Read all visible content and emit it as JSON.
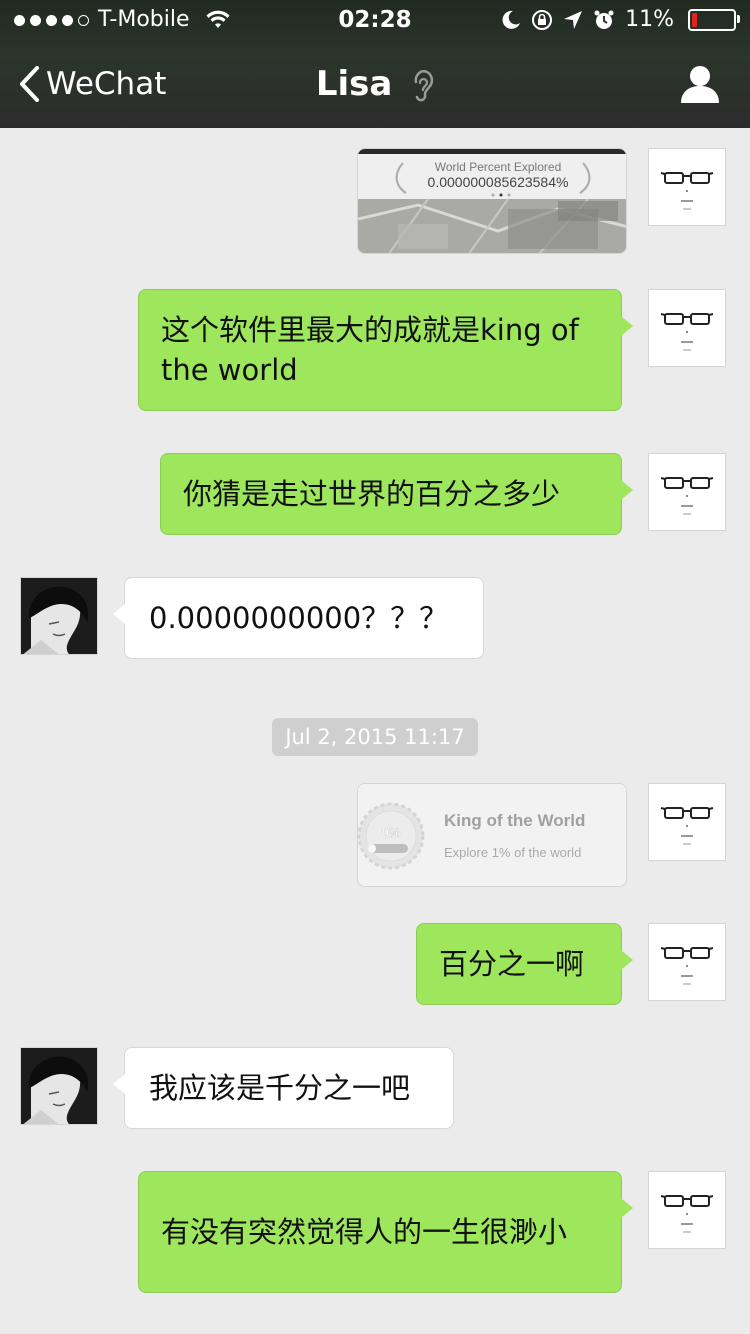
{
  "status_bar": {
    "carrier": "T-Mobile",
    "time": "02:28",
    "battery_percent": "11%",
    "signal_bars_filled": 4
  },
  "nav": {
    "back_label": "WeChat",
    "title": "Lisa"
  },
  "messages": [
    {
      "sender": "me",
      "type": "image",
      "caption_title": "World Percent Explored",
      "caption_value": "0.000000085623584%"
    },
    {
      "sender": "me",
      "type": "text",
      "text": "这个软件里最大的成就是king of the world"
    },
    {
      "sender": "me",
      "type": "text",
      "text": "你猜是走过世界的百分之多少"
    },
    {
      "sender": "lisa",
      "type": "text",
      "text": "0.0000000000？？？"
    },
    {
      "type": "timestamp",
      "text": "Jul 2, 2015 11:17"
    },
    {
      "sender": "me",
      "type": "achievement",
      "badge": "0%",
      "title": "King of the World",
      "subtitle": "Explore 1% of the world",
      "progress": 0
    },
    {
      "sender": "me",
      "type": "text",
      "text": "百分之一啊"
    },
    {
      "sender": "lisa",
      "type": "text",
      "text": "我应该是千分之一吧"
    },
    {
      "sender": "me",
      "type": "text",
      "text": "有没有突然觉得人的一生很渺小"
    }
  ],
  "colors": {
    "background": "#ebebeb",
    "sent_bubble": "#9ee65c",
    "received_bubble": "#ffffff",
    "top_bar": "#2b352b",
    "battery_low": "#e0241f"
  }
}
